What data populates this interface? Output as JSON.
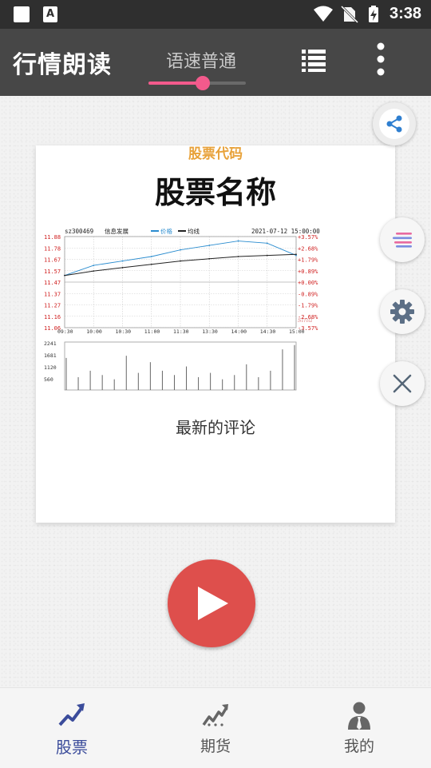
{
  "status_bar": {
    "time": "3:38",
    "notification_icons": [
      "square-notification-icon",
      "a-notification-icon"
    ],
    "system_icons": [
      "wifi-icon",
      "no-sim-icon",
      "battery-charging-icon"
    ]
  },
  "app_bar": {
    "title": "行情朗读",
    "speed_label": "语速普通",
    "speed_level": 0.56,
    "actions": [
      "list-icon",
      "more-vert-icon"
    ]
  },
  "card": {
    "stock_code_label": "股票代码",
    "stock_name_label": "股票名称",
    "comment_label": "最新的评论",
    "chart": {
      "symbol": "sz300469",
      "name": "信息发展",
      "legend_price": "价格",
      "legend_avg": "均线",
      "datetime": "2021-07-12 15:00:00",
      "watermark": "sina",
      "price_ticks": [
        "11.88",
        "11.78",
        "11.67",
        "11.57",
        "11.47",
        "11.37",
        "11.27",
        "11.16",
        "11.06"
      ],
      "pct_ticks": [
        "+3.57%",
        "+2.68%",
        "+1.79%",
        "+0.89%",
        "+0.00%",
        "-0.89%",
        "-1.79%",
        "-2.68%",
        "-3.57%"
      ],
      "time_ticks": [
        "09:30",
        "10:00",
        "10:30",
        "11:00",
        "11:30",
        "13:30",
        "14:00",
        "14:30",
        "15:00"
      ],
      "volume_ticks": [
        "2241",
        "1681",
        "1120",
        "560"
      ]
    }
  },
  "chart_data": {
    "type": "line",
    "x": [
      "09:30",
      "10:00",
      "10:30",
      "11:00",
      "11:30",
      "13:30",
      "14:00",
      "14:30",
      "15:00"
    ],
    "series": [
      {
        "name": "价格",
        "values": [
          11.53,
          11.62,
          11.66,
          11.7,
          11.76,
          11.8,
          11.84,
          11.82,
          11.71
        ]
      },
      {
        "name": "均线",
        "values": [
          11.53,
          11.57,
          11.6,
          11.63,
          11.66,
          11.68,
          11.7,
          11.71,
          11.72
        ]
      }
    ],
    "ylim": [
      11.06,
      11.88
    ],
    "volume": [
      1500,
      600,
      900,
      700,
      500,
      1600,
      800,
      1300,
      900,
      700,
      1100,
      600,
      800,
      500,
      700,
      1200,
      600,
      900,
      1900,
      2100
    ],
    "volume_ylim": [
      0,
      2241
    ],
    "colors": {
      "price": "#2a8ccf",
      "avg": "#222222",
      "pct": "#d02020",
      "price_axis": "#d02020"
    }
  },
  "floating_actions": [
    "share-icon",
    "menu-lines-icon",
    "gear-icon",
    "close-icon"
  ],
  "play": {
    "icon": "play-icon"
  },
  "bottom_nav": {
    "items": [
      {
        "label": "股票",
        "icon": "trend-up-icon",
        "active": true
      },
      {
        "label": "期货",
        "icon": "futures-trend-icon",
        "active": false
      },
      {
        "label": "我的",
        "icon": "profile-icon",
        "active": false
      }
    ]
  },
  "colors": {
    "accent": "#f35a8c",
    "code_orange": "#e8a23a",
    "play_red": "#de4f4c",
    "nav_active": "#3b4c9b"
  }
}
